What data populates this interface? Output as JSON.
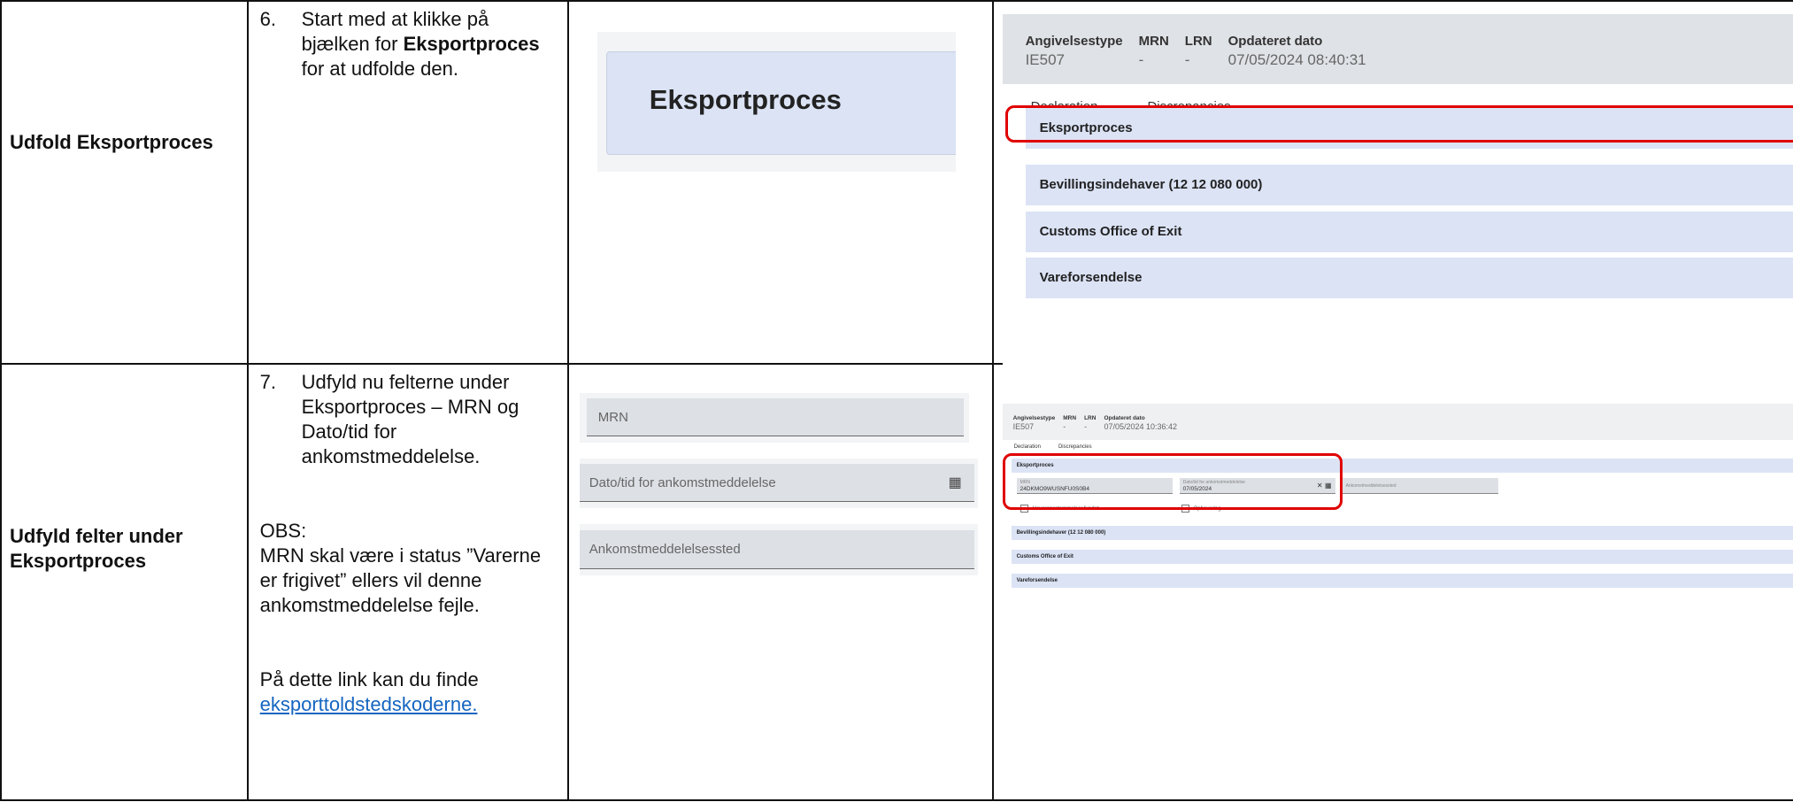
{
  "rows": [
    {
      "label": "Udfold Eksportproces",
      "step_number": "6.",
      "instruction": {
        "before": "Start med at klikke på bjælken for ",
        "bold": "Eksportproces",
        "after": " for at udfolde den."
      },
      "zoom_label": "Eksportproces",
      "screenshot": {
        "header": [
          {
            "key": "Angivelsestype",
            "value": "IE507"
          },
          {
            "key": "MRN",
            "value": "-"
          },
          {
            "key": "LRN",
            "value": "-"
          },
          {
            "key": "Opdateret dato",
            "value": "07/05/2024 08:40:31"
          }
        ],
        "tabs": [
          "Declaration",
          "Discrepancies"
        ],
        "sections": [
          "Eksportproces",
          "Bevillingsindehaver (12 12 080 000)",
          "Customs Office of Exit",
          "Vareforsendelse"
        ]
      }
    },
    {
      "label": "Udfyld felter under Eksportproces",
      "step_number": "7.",
      "instruction": "Udfyld nu felterne under Eksportproces – MRN og Dato/tid for ankomstmeddelelse.",
      "obs_title": "OBS:",
      "obs_text": "MRN skal være i status ”Varerne er frigivet” ellers vil denne ankomstmeddelelse fejle.",
      "link_intro": "På dette link kan du finde",
      "link_text": "eksporttoldstedskoderne.",
      "zoom_fields": {
        "mrn": "MRN",
        "date": "Dato/tid for ankomstmeddelelse",
        "place": "Ankomstmeddelelsessted"
      },
      "screenshot": {
        "header": [
          {
            "key": "Angivelsestype",
            "value": "IE507"
          },
          {
            "key": "MRN",
            "value": "-"
          },
          {
            "key": "LRN",
            "value": "-"
          },
          {
            "key": "Opdateret dato",
            "value": "07/05/2024 10:36:42"
          }
        ],
        "tabs": [
          "Declaration",
          "Discrepancies"
        ],
        "expanded_section": "Eksportproces",
        "fields": [
          {
            "label": "MRN",
            "value": "24DKMO9WUSNFU0S0B4"
          },
          {
            "label": "Dato/tid for ankomstmeddelelse",
            "value": "07/05/2024"
          },
          {
            "label": "Ankomstmeddelelsessted",
            "value": ""
          }
        ],
        "checkboxes": [
          "Uoverensstemmelser fundet",
          "Opbevaring"
        ],
        "sections": [
          "Bevillingsindehaver (12 12 080 000)",
          "Customs Office of Exit",
          "Vareforsendelse"
        ]
      }
    }
  ],
  "accent": {
    "red": "#e00000",
    "section_bg": "#dbe3f5",
    "tab_underline": "#e0a800",
    "link": "#1565c0"
  }
}
